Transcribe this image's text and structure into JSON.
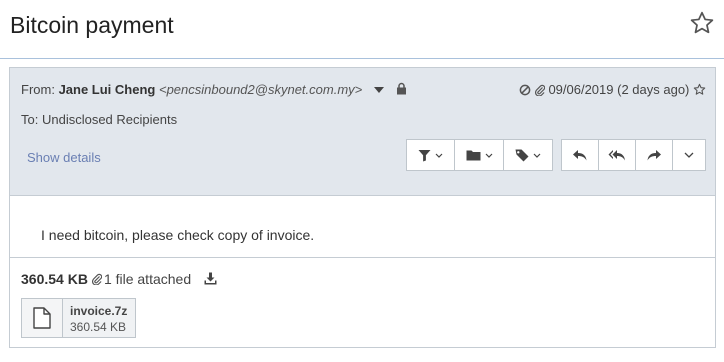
{
  "subject": "Bitcoin payment",
  "header": {
    "from_prefix": "From: ",
    "from_name": "Jane Lui Cheng",
    "from_email": "<pencsinbound2@skynet.com.my>",
    "date": "09/06/2019 (2 days ago)",
    "to_label": "To: ",
    "to_value": "Undisclosed Recipients",
    "show_details": "Show details"
  },
  "toolbar": {
    "left_group": [
      "filter-icon",
      "folder-icon",
      "tag-icon"
    ],
    "right_group": [
      "reply-icon",
      "reply-all-icon",
      "forward-icon",
      "more-chevron-icon"
    ]
  },
  "body": {
    "text": "I need bitcoin, please check copy of invoice."
  },
  "attachments": {
    "total_size": "360.54 KB",
    "count_text": "1 file attached",
    "files": [
      {
        "name": "invoice.7z",
        "size": "360.54 KB"
      }
    ]
  },
  "colors": {
    "header_bg": "#e2e7ed",
    "link": "#6a7fb3",
    "divider": "#a9c1dc"
  }
}
